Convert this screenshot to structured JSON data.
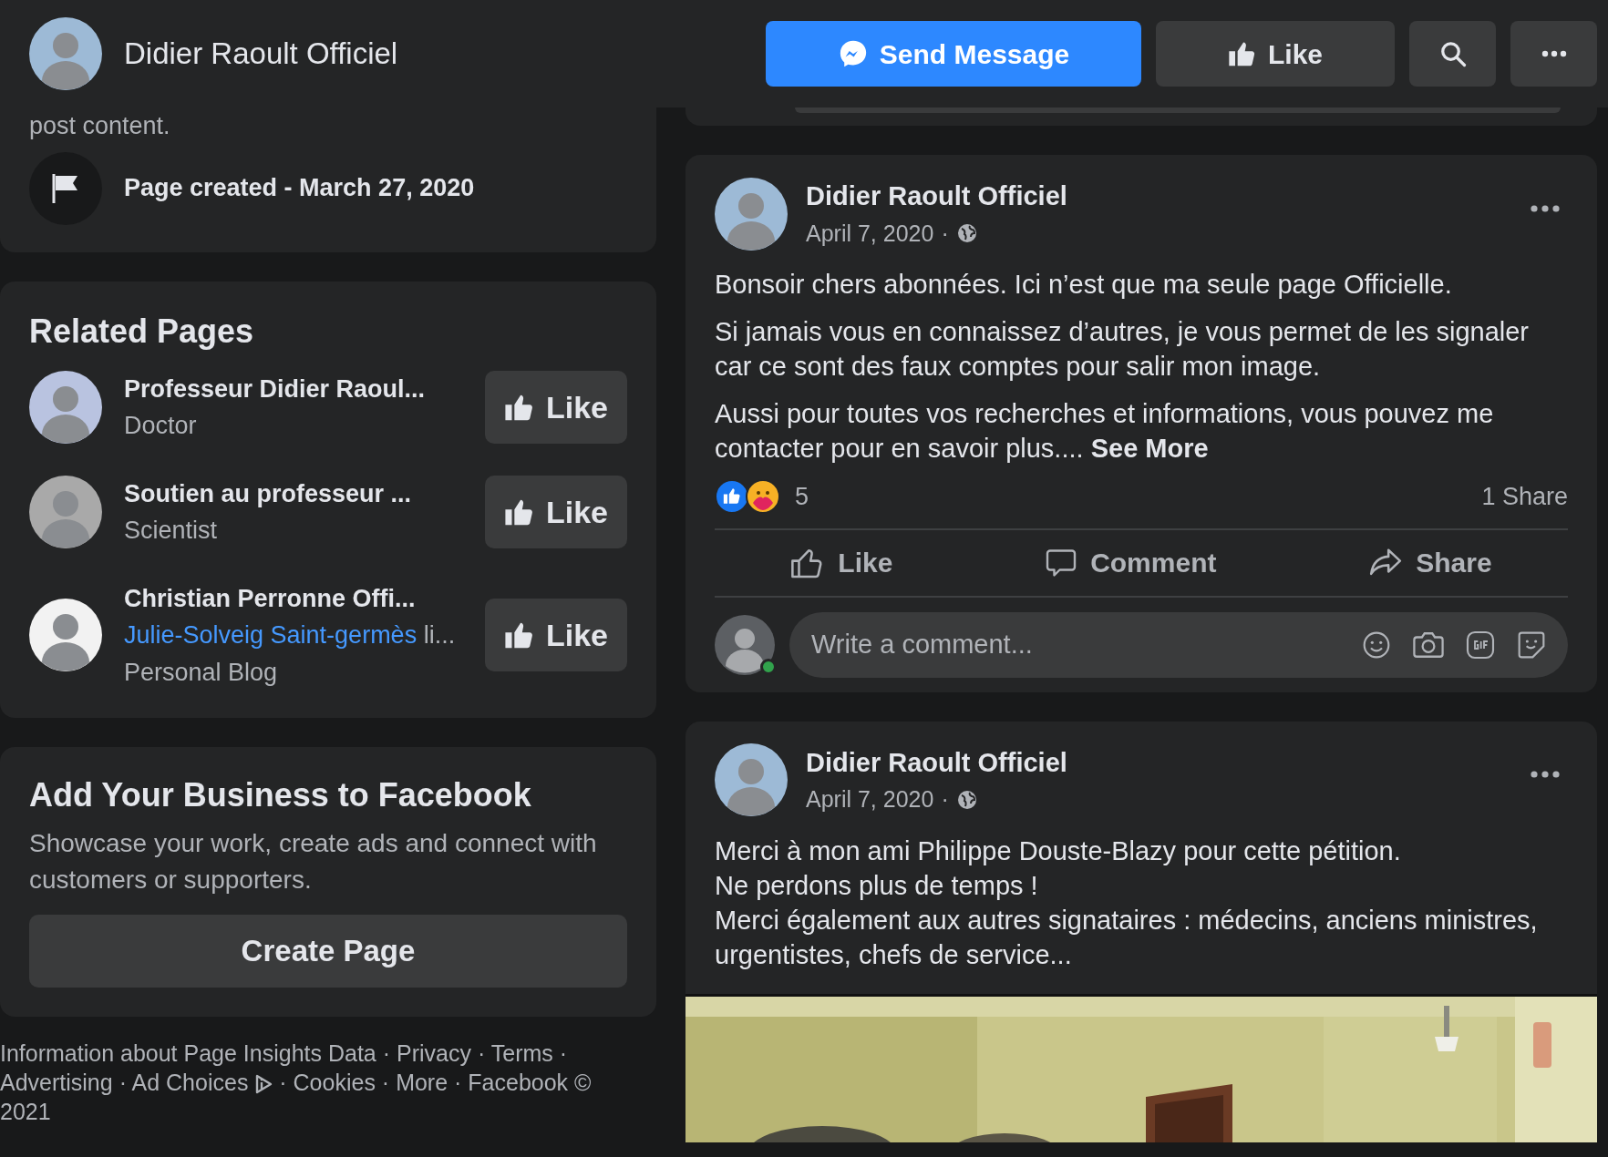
{
  "header": {
    "page_name": "Didier Raoult Officiel",
    "buttons": [
      {
        "kind": "message",
        "label": "Send Message"
      },
      {
        "kind": "like",
        "label": "Like"
      },
      {
        "kind": "search"
      },
      {
        "kind": "more"
      }
    ]
  },
  "about": {
    "text": "post content.",
    "created": "Page created - March 27, 2020"
  },
  "related_pages": {
    "title": "Related Pages",
    "items": [
      {
        "name": "Professeur Didier Raoul...",
        "category": "Doctor",
        "button": "Like"
      },
      {
        "name": "Soutien au professeur ...",
        "category": "Scientist",
        "button": "Like"
      },
      {
        "name": "Christian Perronne Offi...",
        "liked_by": "Julie-Solveig Saint-germès",
        "liked_rest": "li...",
        "category": "Personal Blog",
        "button": "Like"
      }
    ]
  },
  "business": {
    "title": "Add Your Business to Facebook",
    "text": "Showcase your work, create ads and connect with customers or supporters.",
    "button": "Create Page"
  },
  "footer": {
    "separator": "·",
    "links": [
      {
        "kind": "link",
        "label": "Information about Page Insights Data"
      },
      {
        "kind": "link",
        "label": "Privacy"
      },
      {
        "kind": "link",
        "label": "Terms"
      },
      {
        "kind": "link",
        "label": "Advertising"
      },
      {
        "kind": "adchoices",
        "label": "Ad Choices"
      },
      {
        "kind": "link",
        "label": "Cookies"
      },
      {
        "kind": "link",
        "label": "More"
      },
      {
        "kind": "text",
        "label": "Facebook © 2021"
      }
    ]
  },
  "posts": [
    {
      "author": "Didier Raoult Officiel",
      "date": "April 7, 2020",
      "date_separator": "·",
      "paragraphs": [
        "Bonsoir chers abonnées. Ici n’est que ma seule page Officielle.",
        "Si jamais vous en connaissez d’autres, je vous permet de les signaler car ce sont des faux comptes pour salir mon image.",
        "Aussi pour toutes vos recherches et informations, vous pouvez me contacter pour en savoir plus...."
      ],
      "see_more": "See More",
      "reactions": "5",
      "shares": "1 Share",
      "actions": [
        "Like",
        "Comment",
        "Share"
      ],
      "comment_placeholder": "Write a comment..."
    },
    {
      "author": "Didier Raoult Officiel",
      "date": "April 7, 2020",
      "date_separator": "·",
      "lines": [
        "Merci à mon ami Philippe Douste-Blazy pour cette pétition.",
        "Ne perdons plus de temps !",
        "Merci également aux autres signataires : médecins, anciens ministres, urgentistes, chefs de service..."
      ],
      "media": {
        "kind": "picture"
      }
    }
  ]
}
